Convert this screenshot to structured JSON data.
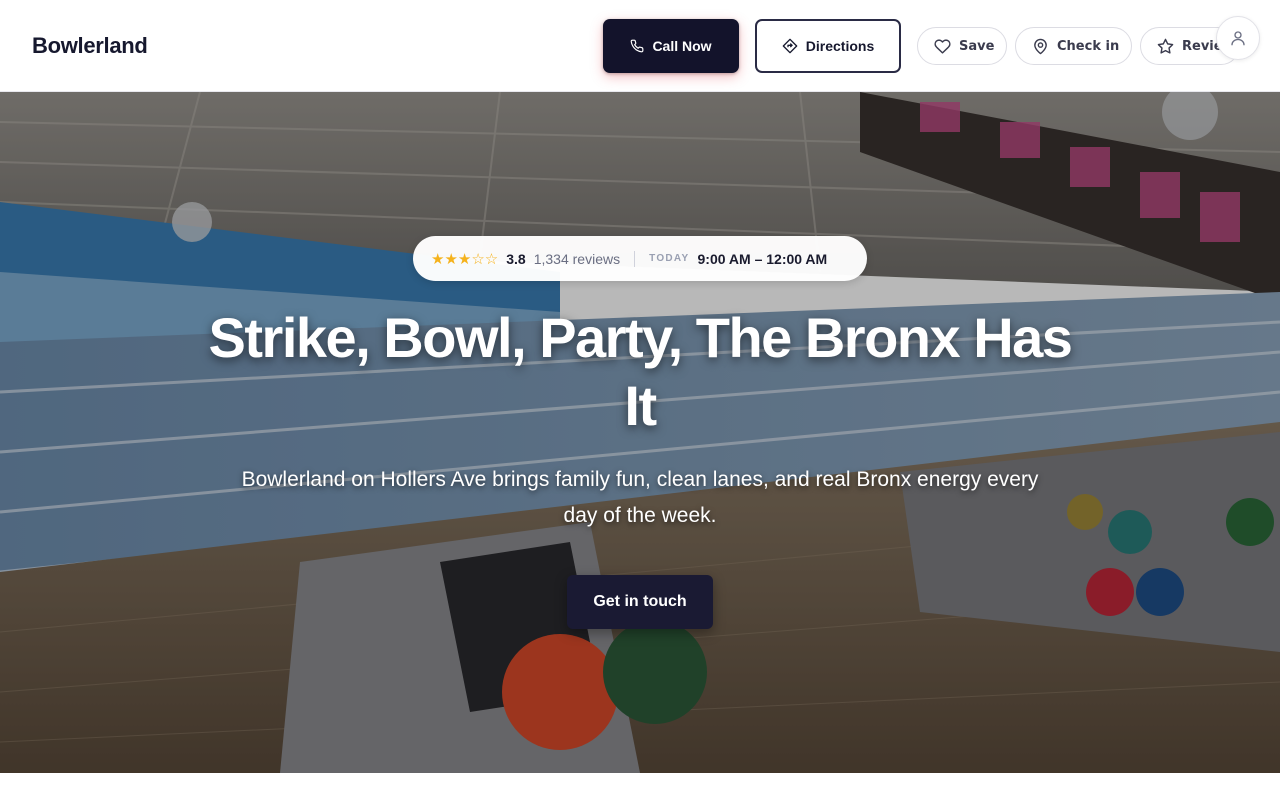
{
  "brand": {
    "name": "Bowlerland"
  },
  "header": {
    "call_label": "Call Now",
    "directions_label": "Directions",
    "save_label": "Save",
    "checkin_label": "Check in",
    "review_label": "Review"
  },
  "hero": {
    "rating": {
      "stars": "★★★☆☆",
      "value": "3.8",
      "reviews": "1,334 reviews"
    },
    "today_label": "TODAY",
    "hours": "9:00 AM – 12:00 AM",
    "title": "Strike, Bowl, Party, The Bronx Has It",
    "subtitle": "Bowlerland on Hollers Ave brings family fun, clean lanes, and real Bronx energy every day of the week.",
    "cta_label": "Get in touch"
  },
  "colors": {
    "primary": "#13132b",
    "star": "#f5b21c",
    "muted": "#6a6e82"
  },
  "icons": {
    "call": "phone-icon",
    "directions": "directions-icon",
    "save": "heart-icon",
    "checkin": "map-pin-icon",
    "review": "star-icon",
    "account": "user-icon"
  }
}
